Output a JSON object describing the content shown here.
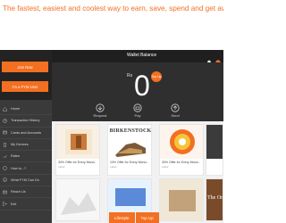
{
  "tagline": "The fastest, easiest and coolest way to earn, save, spend and get awesome deals",
  "sidebar": {
    "join_label": "Join Now",
    "fym_label": "I'm a FYM User",
    "items": [
      {
        "label": "Home",
        "icon": "home-icon"
      },
      {
        "label": "Transaction History",
        "icon": "history-icon"
      },
      {
        "label": "Cards and Accounts",
        "icon": "card-icon"
      },
      {
        "label": "My Devices",
        "icon": "device-icon"
      },
      {
        "label": "Rates",
        "icon": "rates-icon"
      },
      {
        "label": "How to...?",
        "icon": "help-icon"
      },
      {
        "label": "What FYM Can Do",
        "icon": "info-icon"
      },
      {
        "label": "Reach Us",
        "icon": "mail-icon"
      },
      {
        "label": "Exit",
        "icon": "exit-icon"
      }
    ]
  },
  "appbar": {
    "title": "Wallet Balance"
  },
  "wallet": {
    "currency": "Rs",
    "balance": "0",
    "badge": "Top Up",
    "actions": [
      {
        "label": "Request",
        "icon": "request-icon"
      },
      {
        "label": "Pay",
        "icon": "pay-icon"
      },
      {
        "label": "Send",
        "icon": "send-icon"
      }
    ]
  },
  "cards": [
    {
      "brand": "",
      "caption": "30% Offer for Every Mond...",
      "sub": "Label"
    },
    {
      "brand": "BIRKENSTOCK",
      "caption": "10% Offer for Every Mond...",
      "sub": "Label"
    },
    {
      "brand": "",
      "caption": "30% Offer for Every Mond...",
      "sub": "Label"
    }
  ],
  "row2_brand": "The Orig",
  "tabs": [
    "Lifestyle",
    "Top Up"
  ],
  "colors": {
    "accent": "#f36f21",
    "dark": "#2b2b2b"
  }
}
